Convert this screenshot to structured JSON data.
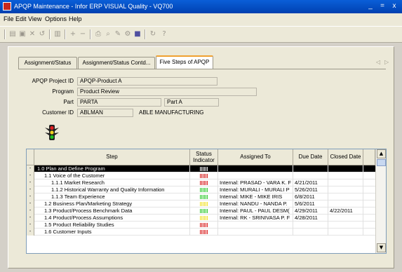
{
  "window": {
    "title": "APQP Maintenance - Infor ERP VISUAL Quality - VQ700",
    "minimize": "_",
    "maximize": "=",
    "close": "x"
  },
  "menu": [
    {
      "label": "File"
    },
    {
      "label": "Edit"
    },
    {
      "label": "View"
    },
    {
      "label": "Options"
    },
    {
      "label": "Help"
    }
  ],
  "tabs": [
    {
      "label": "Assignment/Status",
      "active": false
    },
    {
      "label": "Assignment/Status Contd...",
      "active": false
    },
    {
      "label": "Five Steps of APQP",
      "active": true
    }
  ],
  "tab_nav": {
    "prev": "◁",
    "next": "▷"
  },
  "form": {
    "project_label": "APQP Project ID",
    "project_value": "APQP-Product A",
    "program_label": "Program",
    "program_value": "Product Review",
    "part_label": "Part",
    "part_value": "PARTA",
    "part_desc": "Part A",
    "customer_label": "Customer ID",
    "customer_value": "ABLMAN",
    "customer_name": "ABLE MANUFACTURING"
  },
  "grid": {
    "columns": {
      "step": "Step",
      "status_1": "Status",
      "status_2": "Indicator",
      "assigned": "Assigned To",
      "due": "Due Date",
      "closed": "Closed Date"
    },
    "rows": [
      {
        "marker": "-",
        "step": "1.0  Plan and Define Program",
        "indent": 0,
        "status": "#ffffff",
        "assigned": "",
        "due": "",
        "closed": "",
        "selected": true
      },
      {
        "marker": "-",
        "step": "1.1  Voice of the Customer",
        "indent": 1,
        "status": "#d81818",
        "assigned": "",
        "due": "",
        "closed": "",
        "selected": false
      },
      {
        "marker": "-",
        "step": "1.1.1  Market Research",
        "indent": 2,
        "status": "#d81818",
        "assigned": "Internal:  PRASAD - VARA K. F",
        "due": "4/21/2011",
        "closed": "",
        "selected": false
      },
      {
        "marker": "-",
        "step": "1.1.2  Historical Warranty and Quality Information",
        "indent": 2,
        "status": "#28c828",
        "assigned": "Internal:  MURALI - MURALI P",
        "due": "5/26/2011",
        "closed": "",
        "selected": false
      },
      {
        "marker": "-",
        "step": "1.1.3  Team Experience",
        "indent": 2,
        "status": "#28c828",
        "assigned": "Internal:  MIKE - MIKE IRIS",
        "due": "6/8/2011",
        "closed": "",
        "selected": false
      },
      {
        "marker": "-",
        "step": "1.2  Business Plan/Marketing Strategy",
        "indent": 1,
        "status": "#f0e020",
        "assigned": "Internal:  NANDU - NANDA P.",
        "due": "5/6/2011",
        "closed": "",
        "selected": false
      },
      {
        "marker": "-",
        "step": "1.3  Product/Process Benchmark Data",
        "indent": 1,
        "status": "#28c828",
        "assigned": "Internal:  PAUL - PAUL DESM(",
        "due": "4/29/2011",
        "closed": "4/22/2011",
        "selected": false
      },
      {
        "marker": "-",
        "step": "1.4  Product/Process Assumptions",
        "indent": 1,
        "status": "#f0e020",
        "assigned": "Internal:  RK - SRINIVASA P. F",
        "due": "4/28/2011",
        "closed": "",
        "selected": false
      },
      {
        "marker": "-",
        "step": "1.5  Product Reliability Studies",
        "indent": 1,
        "status": "#d81818",
        "assigned": "",
        "due": "",
        "closed": "",
        "selected": false
      },
      {
        "marker": "-",
        "step": "1.6  Customer Inputs",
        "indent": 1,
        "status": "#d81818",
        "assigned": "",
        "due": "",
        "closed": "",
        "selected": false
      }
    ]
  },
  "scroll": {
    "up": "▲",
    "down": "▼"
  },
  "colors": {
    "title_bar": "#0a5fd8",
    "active_tab_accent": "#f0a030"
  }
}
